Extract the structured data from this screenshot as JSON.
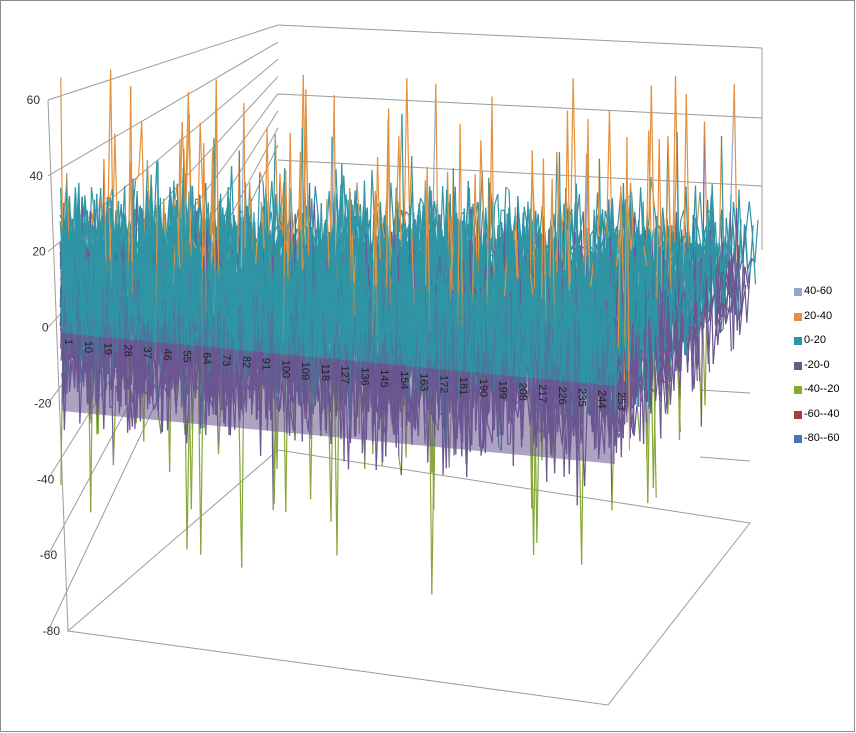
{
  "chart_data": {
    "type": "surface",
    "title": "",
    "z_axis": {
      "min": -80,
      "max": 60,
      "step": 20,
      "ticks": [
        "60",
        "40",
        "20",
        "0",
        "-20",
        "-40",
        "-60",
        "-80"
      ]
    },
    "x_axis": {
      "ticks": [
        "1",
        "10",
        "19",
        "28",
        "37",
        "46",
        "55",
        "64",
        "73",
        "82",
        "91",
        "100",
        "109",
        "118",
        "127",
        "136",
        "145",
        "154",
        "163",
        "172",
        "181",
        "190",
        "199",
        "208",
        "217",
        "226",
        "235",
        "244",
        "253"
      ]
    },
    "series_approx": {
      "mean": 0,
      "spread": 18,
      "min_spike": -75,
      "max_spike": 62,
      "points": 253,
      "rows": 60
    },
    "legend": {
      "position": "right",
      "items": [
        {
          "label": "40-60",
          "color": "#95a8cc"
        },
        {
          "label": "20-40",
          "color": "#e4913d"
        },
        {
          "label": "0-20",
          "color": "#2f95a5"
        },
        {
          "label": "-20-0",
          "color": "#6a5690"
        },
        {
          "label": "-40--20",
          "color": "#86a83a"
        },
        {
          "label": "-60--40",
          "color": "#a33f3c"
        },
        {
          "label": "-80--60",
          "color": "#4a73b0"
        }
      ]
    }
  }
}
